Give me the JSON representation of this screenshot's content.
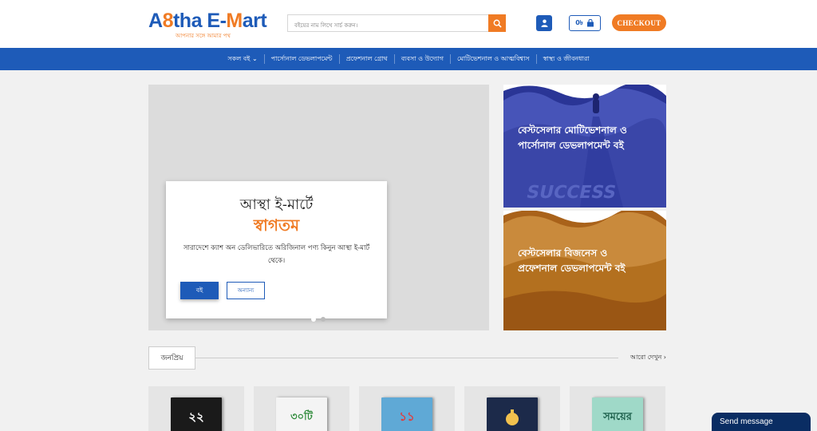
{
  "header": {
    "logo_prefix": "A",
    "logo_accent": "8",
    "logo_suffix": "tha E-",
    "logo_mart_m": "M",
    "logo_mart_rest": "art",
    "logo_tagline": "আপনার সঙ্গে আমার পথ",
    "search_placeholder": "বইয়ের নাম লিখে সার্চ করুন।",
    "cart_amount": "0৳",
    "checkout_label": "CHECKOUT"
  },
  "nav": {
    "items": [
      {
        "label": "সকল বই ⌄"
      },
      {
        "label": "পার্সোনাল ডেভলাপমেন্ট"
      },
      {
        "label": "প্রফেশনাল গ্রোথ"
      },
      {
        "label": "ব্যবসা ও উদ্যোগ"
      },
      {
        "label": "মোটিভেশনাল ও আত্মবিশ্বাস"
      },
      {
        "label": "স্বাস্থ্য ও জীবনধারা"
      }
    ]
  },
  "hero": {
    "line1": "আস্থা ই-মার্টে",
    "line2": "স্বাগতম",
    "description": "সারাদেশে ক্যাশ অন ডেলিভারিতে অরিজিনাল পণ্য কিনুন আস্থা ই-মার্ট থেকে।",
    "button_books": "বই",
    "button_other": "অন্যান্য"
  },
  "banners": {
    "first": {
      "text": "বেস্টসেলার মোটিভেশনাল ও পার্সোনাল ডেভলাপমেন্ট বই",
      "overlay_word": "SUCCESS"
    },
    "second": {
      "text": "বেস্টসেলার বিজনেস ও প্রফেশনাল ডেভলাপমেন্ট বই"
    }
  },
  "popular": {
    "tab_label": "জনপ্রিয়",
    "see_more": "আরো দেখুন"
  },
  "products": [
    {
      "cover_text": "২২",
      "cover_color": "#1a1a1a",
      "text_color": "#ffffff"
    },
    {
      "cover_text": "৩০টি",
      "cover_color": "#f4f4f4",
      "text_color": "#2e8b3a"
    },
    {
      "cover_text": "১১",
      "cover_color": "#5fa9d6",
      "text_color": "#e23b3b"
    },
    {
      "cover_text": "",
      "cover_color": "#1c2a4a",
      "text_color": "#f2c14e"
    },
    {
      "cover_text": "সময়ের",
      "cover_color": "#9fd9c8",
      "text_color": "#1b5e4a"
    }
  ],
  "chat": {
    "label": "Send message"
  },
  "colors": {
    "brand_blue": "#1e5bb8",
    "brand_orange": "#f07b24"
  }
}
